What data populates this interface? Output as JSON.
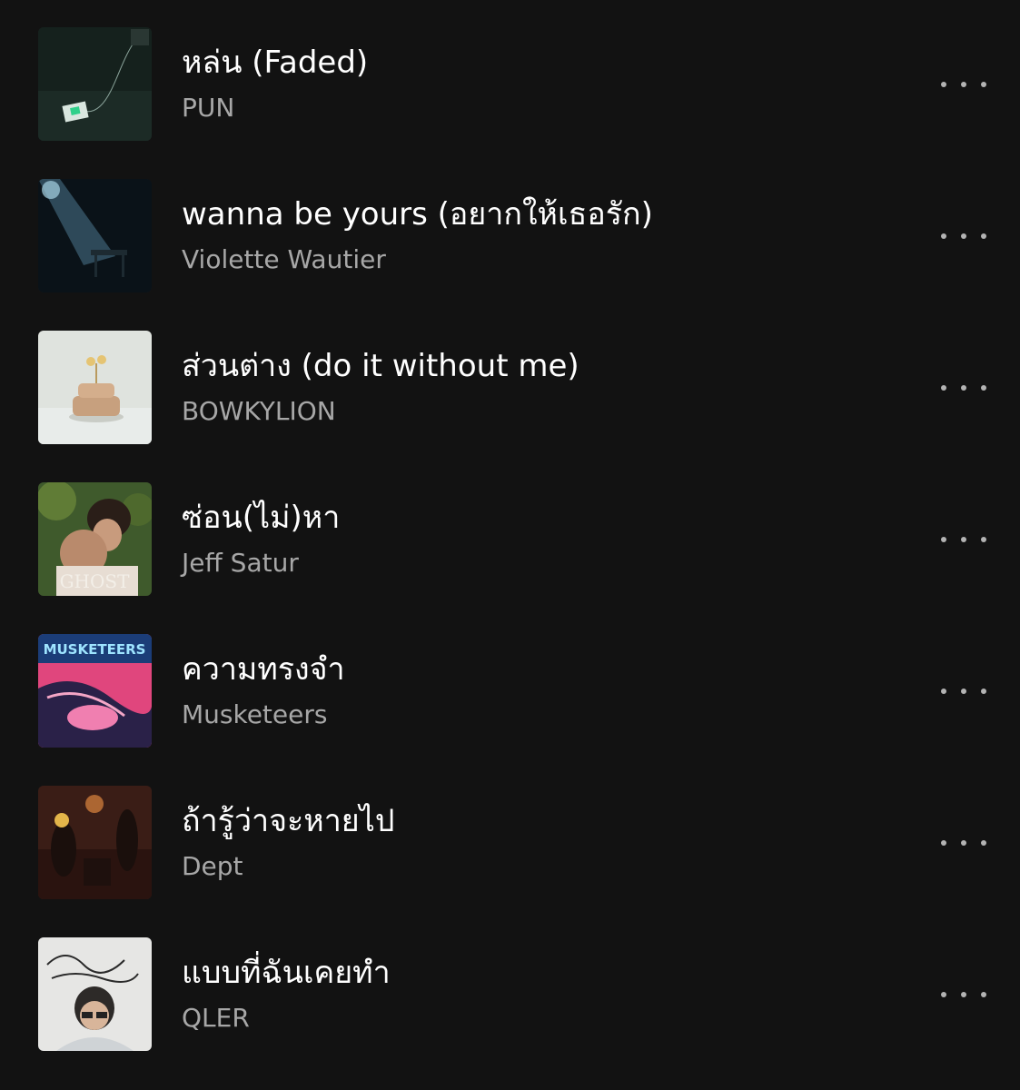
{
  "tracks": [
    {
      "title": "หล่น (Faded)",
      "artist": "PUN",
      "cover_icon": "album-cover-image",
      "more_icon": "more-options-icon"
    },
    {
      "title": "wanna be yours (อยากให้เธอรัก)",
      "artist": "Violette Wautier",
      "cover_icon": "album-cover-image",
      "more_icon": "more-options-icon"
    },
    {
      "title": "ส่วนต่าง (do it without me)",
      "artist": "BOWKYLION",
      "cover_icon": "album-cover-image",
      "more_icon": "more-options-icon"
    },
    {
      "title": "ซ่อน(ไม่)หา",
      "artist": "Jeff Satur",
      "cover_icon": "album-cover-image",
      "more_icon": "more-options-icon",
      "cover_text": "GHOST"
    },
    {
      "title": "ความทรงจำ",
      "artist": "Musketeers",
      "cover_icon": "album-cover-image",
      "more_icon": "more-options-icon",
      "cover_text": "MUSKETEERS"
    },
    {
      "title": "ถ้ารู้ว่าจะหายไป",
      "artist": "Dept",
      "cover_icon": "album-cover-image",
      "more_icon": "more-options-icon"
    },
    {
      "title": "แบบที่ฉันเคยทำ",
      "artist": "QLER",
      "cover_icon": "album-cover-image",
      "more_icon": "more-options-icon"
    }
  ],
  "colors": {
    "background": "#121212",
    "title": "#ffffff",
    "artist": "#a7a7a7",
    "dots": "#b3b3b3"
  }
}
